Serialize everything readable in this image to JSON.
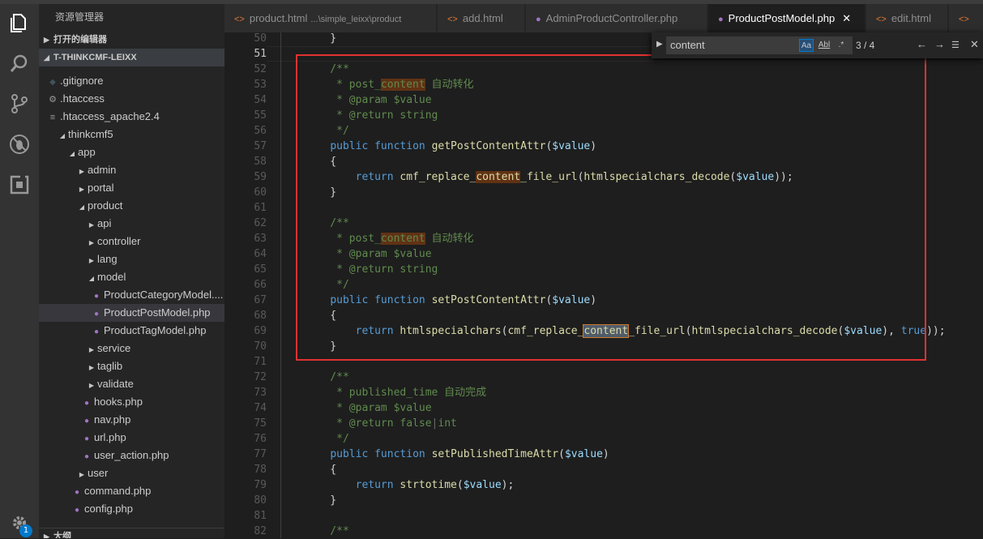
{
  "explorer": {
    "title": "资源管理器",
    "open_editors": "打开的编辑器",
    "root": "T-THINKCMF-LEIXX",
    "outline": "大纲",
    "items": [
      {
        "label": ".gitignore",
        "indent": 1,
        "icon": "gitignore-icon",
        "twisty": ""
      },
      {
        "label": ".htaccess",
        "indent": 1,
        "icon": "gear-icon",
        "twisty": ""
      },
      {
        "label": ".htaccess_apache2.4",
        "indent": 1,
        "icon": "lines-icon",
        "twisty": ""
      },
      {
        "label": "thinkcmf5",
        "indent": 0,
        "icon": "",
        "twisty": "open"
      },
      {
        "label": "app",
        "indent": 1,
        "icon": "",
        "twisty": "open"
      },
      {
        "label": "admin",
        "indent": 2,
        "icon": "",
        "twisty": "closed"
      },
      {
        "label": "portal",
        "indent": 2,
        "icon": "",
        "twisty": "closed"
      },
      {
        "label": "product",
        "indent": 2,
        "icon": "",
        "twisty": "open"
      },
      {
        "label": "api",
        "indent": 3,
        "icon": "",
        "twisty": "closed"
      },
      {
        "label": "controller",
        "indent": 3,
        "icon": "",
        "twisty": "closed"
      },
      {
        "label": "lang",
        "indent": 3,
        "icon": "",
        "twisty": "closed"
      },
      {
        "label": "model",
        "indent": 3,
        "icon": "",
        "twisty": "open"
      },
      {
        "label": "ProductCategoryModel....",
        "indent": 4,
        "icon": "php-icon",
        "twisty": ""
      },
      {
        "label": "ProductPostModel.php",
        "indent": 4,
        "icon": "php-icon",
        "twisty": "",
        "selected": true
      },
      {
        "label": "ProductTagModel.php",
        "indent": 4,
        "icon": "php-icon",
        "twisty": ""
      },
      {
        "label": "service",
        "indent": 3,
        "icon": "",
        "twisty": "closed"
      },
      {
        "label": "taglib",
        "indent": 3,
        "icon": "",
        "twisty": "closed"
      },
      {
        "label": "validate",
        "indent": 3,
        "icon": "",
        "twisty": "closed"
      },
      {
        "label": "hooks.php",
        "indent": 3,
        "icon": "php-icon",
        "twisty": ""
      },
      {
        "label": "nav.php",
        "indent": 3,
        "icon": "php-icon",
        "twisty": ""
      },
      {
        "label": "url.php",
        "indent": 3,
        "icon": "php-icon",
        "twisty": ""
      },
      {
        "label": "user_action.php",
        "indent": 3,
        "icon": "php-icon",
        "twisty": ""
      },
      {
        "label": "user",
        "indent": 2,
        "icon": "",
        "twisty": "closed"
      },
      {
        "label": "command.php",
        "indent": 2,
        "icon": "php-icon",
        "twisty": ""
      },
      {
        "label": "config.php",
        "indent": 2,
        "icon": "php-icon",
        "twisty": ""
      }
    ]
  },
  "activity": {
    "badge": "1"
  },
  "tabs": [
    {
      "label": "product.html",
      "path": "...\\simple_leixx\\product",
      "type": "html",
      "active": false
    },
    {
      "label": "add.html",
      "path": "",
      "type": "html",
      "active": false
    },
    {
      "label": "AdminProductController.php",
      "path": "",
      "type": "php",
      "active": false
    },
    {
      "label": "ProductPostModel.php",
      "path": "",
      "type": "php",
      "active": true
    },
    {
      "label": "edit.html",
      "path": "",
      "type": "html",
      "active": false
    },
    {
      "label": "",
      "path": "",
      "type": "html",
      "active": false
    }
  ],
  "find": {
    "query": "content",
    "count": "3 / 4",
    "match_case": "Aa",
    "whole_word": "Abl",
    "regex": ".*"
  },
  "editor": {
    "current_line": 51,
    "lines": [
      {
        "n": 50,
        "t": [
          [
            "    }",
            ""
          ]
        ]
      },
      {
        "n": 51,
        "t": [
          [
            "",
            ""
          ]
        ]
      },
      {
        "n": 52,
        "t": [
          [
            "    /**",
            "cm"
          ]
        ]
      },
      {
        "n": 53,
        "t": [
          [
            "     * post_",
            "cm"
          ],
          [
            "content",
            "cm hl"
          ],
          [
            " 自动转化",
            "cm"
          ]
        ]
      },
      {
        "n": 54,
        "t": [
          [
            "     * @param ",
            "cm"
          ],
          [
            "$value",
            "cm"
          ]
        ]
      },
      {
        "n": 55,
        "t": [
          [
            "     * @return string",
            "cm"
          ]
        ]
      },
      {
        "n": 56,
        "t": [
          [
            "     */",
            "cm"
          ]
        ]
      },
      {
        "n": 57,
        "t": [
          [
            "    ",
            ""
          ],
          [
            "public",
            "kw"
          ],
          [
            " ",
            ""
          ],
          [
            "function",
            "kw"
          ],
          [
            " ",
            ""
          ],
          [
            "getPostContentAttr",
            "fn"
          ],
          [
            "(",
            ""
          ],
          [
            "$value",
            "vr"
          ],
          [
            ")",
            ""
          ]
        ]
      },
      {
        "n": 58,
        "t": [
          [
            "    {",
            ""
          ]
        ]
      },
      {
        "n": 59,
        "t": [
          [
            "        return ",
            "kw2"
          ],
          [
            "cmf_replace_",
            "fn"
          ],
          [
            "content",
            "fn hl"
          ],
          [
            "_file_url",
            "fn"
          ],
          [
            "(",
            ""
          ],
          [
            "htmlspecialchars_decode",
            "fn"
          ],
          [
            "(",
            ""
          ],
          [
            "$value",
            "vr"
          ],
          [
            "));",
            ""
          ]
        ]
      },
      {
        "n": 60,
        "t": [
          [
            "    }",
            ""
          ]
        ]
      },
      {
        "n": 61,
        "t": [
          [
            "",
            ""
          ]
        ]
      },
      {
        "n": 62,
        "t": [
          [
            "    /**",
            "cm"
          ]
        ]
      },
      {
        "n": 63,
        "t": [
          [
            "     * post_",
            "cm"
          ],
          [
            "content",
            "cm hl"
          ],
          [
            " 自动转化",
            "cm"
          ]
        ]
      },
      {
        "n": 64,
        "t": [
          [
            "     * @param ",
            "cm"
          ],
          [
            "$value",
            "cm"
          ]
        ]
      },
      {
        "n": 65,
        "t": [
          [
            "     * @return string",
            "cm"
          ]
        ]
      },
      {
        "n": 66,
        "t": [
          [
            "     */",
            "cm"
          ]
        ]
      },
      {
        "n": 67,
        "t": [
          [
            "    ",
            ""
          ],
          [
            "public",
            "kw"
          ],
          [
            " ",
            ""
          ],
          [
            "function",
            "kw"
          ],
          [
            " ",
            ""
          ],
          [
            "setPostContentAttr",
            "fn"
          ],
          [
            "(",
            ""
          ],
          [
            "$value",
            "vr"
          ],
          [
            ")",
            ""
          ]
        ]
      },
      {
        "n": 68,
        "t": [
          [
            "    {",
            ""
          ]
        ]
      },
      {
        "n": 69,
        "t": [
          [
            "        return ",
            "kw2"
          ],
          [
            "htmlspecialchars",
            "fn"
          ],
          [
            "(",
            ""
          ],
          [
            "cmf_replace_",
            "fn"
          ],
          [
            "content",
            "fn cur-hl"
          ],
          [
            "_file_url",
            "fn"
          ],
          [
            "(",
            ""
          ],
          [
            "htmlspecialchars_decode",
            "fn"
          ],
          [
            "(",
            ""
          ],
          [
            "$value",
            "vr"
          ],
          [
            "), ",
            ""
          ],
          [
            "true",
            "kw"
          ],
          [
            "));",
            ""
          ]
        ]
      },
      {
        "n": 70,
        "t": [
          [
            "    }",
            ""
          ]
        ]
      },
      {
        "n": 71,
        "t": [
          [
            "",
            ""
          ]
        ]
      },
      {
        "n": 72,
        "t": [
          [
            "    /**",
            "cm"
          ]
        ]
      },
      {
        "n": 73,
        "t": [
          [
            "     * published_time 自动完成",
            "cm"
          ]
        ]
      },
      {
        "n": 74,
        "t": [
          [
            "     * @param ",
            "cm"
          ],
          [
            "$value",
            "cm"
          ]
        ]
      },
      {
        "n": 75,
        "t": [
          [
            "     * @return false",
            "cm"
          ],
          [
            "|",
            "pipe"
          ],
          [
            "int",
            "cm"
          ]
        ]
      },
      {
        "n": 76,
        "t": [
          [
            "     */",
            "cm"
          ]
        ]
      },
      {
        "n": 77,
        "t": [
          [
            "    ",
            ""
          ],
          [
            "public",
            "kw"
          ],
          [
            " ",
            ""
          ],
          [
            "function",
            "kw"
          ],
          [
            " ",
            ""
          ],
          [
            "setPublishedTimeAttr",
            "fn"
          ],
          [
            "(",
            ""
          ],
          [
            "$value",
            "vr"
          ],
          [
            ")",
            ""
          ]
        ]
      },
      {
        "n": 78,
        "t": [
          [
            "    {",
            ""
          ]
        ]
      },
      {
        "n": 79,
        "t": [
          [
            "        return ",
            "kw2"
          ],
          [
            "strtotime",
            "fn"
          ],
          [
            "(",
            ""
          ],
          [
            "$value",
            "vr"
          ],
          [
            ");",
            ""
          ]
        ]
      },
      {
        "n": 80,
        "t": [
          [
            "    }",
            ""
          ]
        ]
      },
      {
        "n": 81,
        "t": [
          [
            "",
            ""
          ]
        ]
      },
      {
        "n": 82,
        "t": [
          [
            "    /**",
            "cm"
          ]
        ]
      }
    ]
  }
}
